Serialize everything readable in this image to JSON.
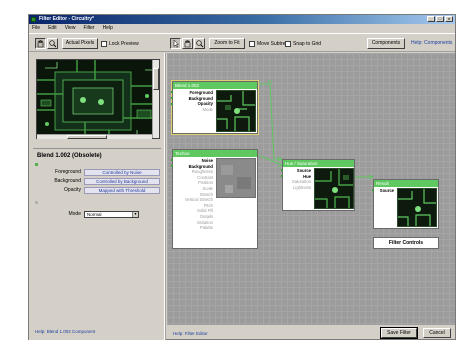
{
  "window": {
    "title": "Filter Editor - Circuitry*"
  },
  "menu": [
    "File",
    "Edit",
    "View",
    "Filter",
    "Help"
  ],
  "toolbar": {
    "actual_pixels": "Actual Pixels",
    "lock_preview": "Lock Preview",
    "zoom_to_fit": "Zoom to Fit",
    "move_subtree": "Move Subtree",
    "snap_to_grid": "Snap to Grid",
    "components": "Components",
    "help_components": "Help: Components"
  },
  "component": {
    "title": "Blend 1.002 (Obsolete)",
    "params": [
      {
        "label": "Foreground",
        "value": "Controlled by Noise"
      },
      {
        "label": "Background",
        "value": "Controlled by Background"
      },
      {
        "label": "Opacity",
        "value": "Mapped with Threshold"
      }
    ],
    "mode_label": "Mode",
    "mode_value": "Normal"
  },
  "left_help": "Help: Blend 1.002 Component",
  "nodes": {
    "blend": {
      "title": "Blend 1.002",
      "ports": [
        {
          "label": "Foreground",
          "active": true
        },
        {
          "label": "Background",
          "active": true
        },
        {
          "label": "Opacity",
          "active": true
        },
        {
          "label": "Mode",
          "active": false
        }
      ]
    },
    "techno": {
      "title": "Techno",
      "ports": [
        {
          "label": "Noise",
          "active": true
        },
        {
          "label": "Background",
          "active": true
        },
        {
          "label": "Roughness",
          "active": false
        },
        {
          "label": "Contrast",
          "active": false
        },
        {
          "label": "Position",
          "active": false
        },
        {
          "label": "Scale",
          "active": false
        },
        {
          "label": "Stretch",
          "active": false
        },
        {
          "label": "Vertical Stretch",
          "active": false
        },
        {
          "label": "Pitch",
          "active": false
        },
        {
          "label": "Solid Fill",
          "active": false
        },
        {
          "label": "Details",
          "active": false
        },
        {
          "label": "Variation",
          "active": false
        },
        {
          "label": "Palette",
          "active": false
        }
      ]
    },
    "hue": {
      "title": "Hue / Saturation",
      "ports": [
        {
          "label": "Source",
          "active": true
        },
        {
          "label": "Hue",
          "active": true
        },
        {
          "label": "Saturation",
          "active": false
        },
        {
          "label": "Lightness",
          "active": false
        }
      ]
    },
    "result": {
      "title": "Result",
      "ports": [
        {
          "label": "Source",
          "active": true
        }
      ]
    }
  },
  "filter_controls": "Filter Controls",
  "right_help": "Help: Filter Editor",
  "buttons": {
    "save_filter": "Save Filter",
    "cancel": "Cancel"
  },
  "colors": {
    "node_header": "#5fc860",
    "connector": "#5fc860",
    "canvas": "#9c9c9c"
  }
}
